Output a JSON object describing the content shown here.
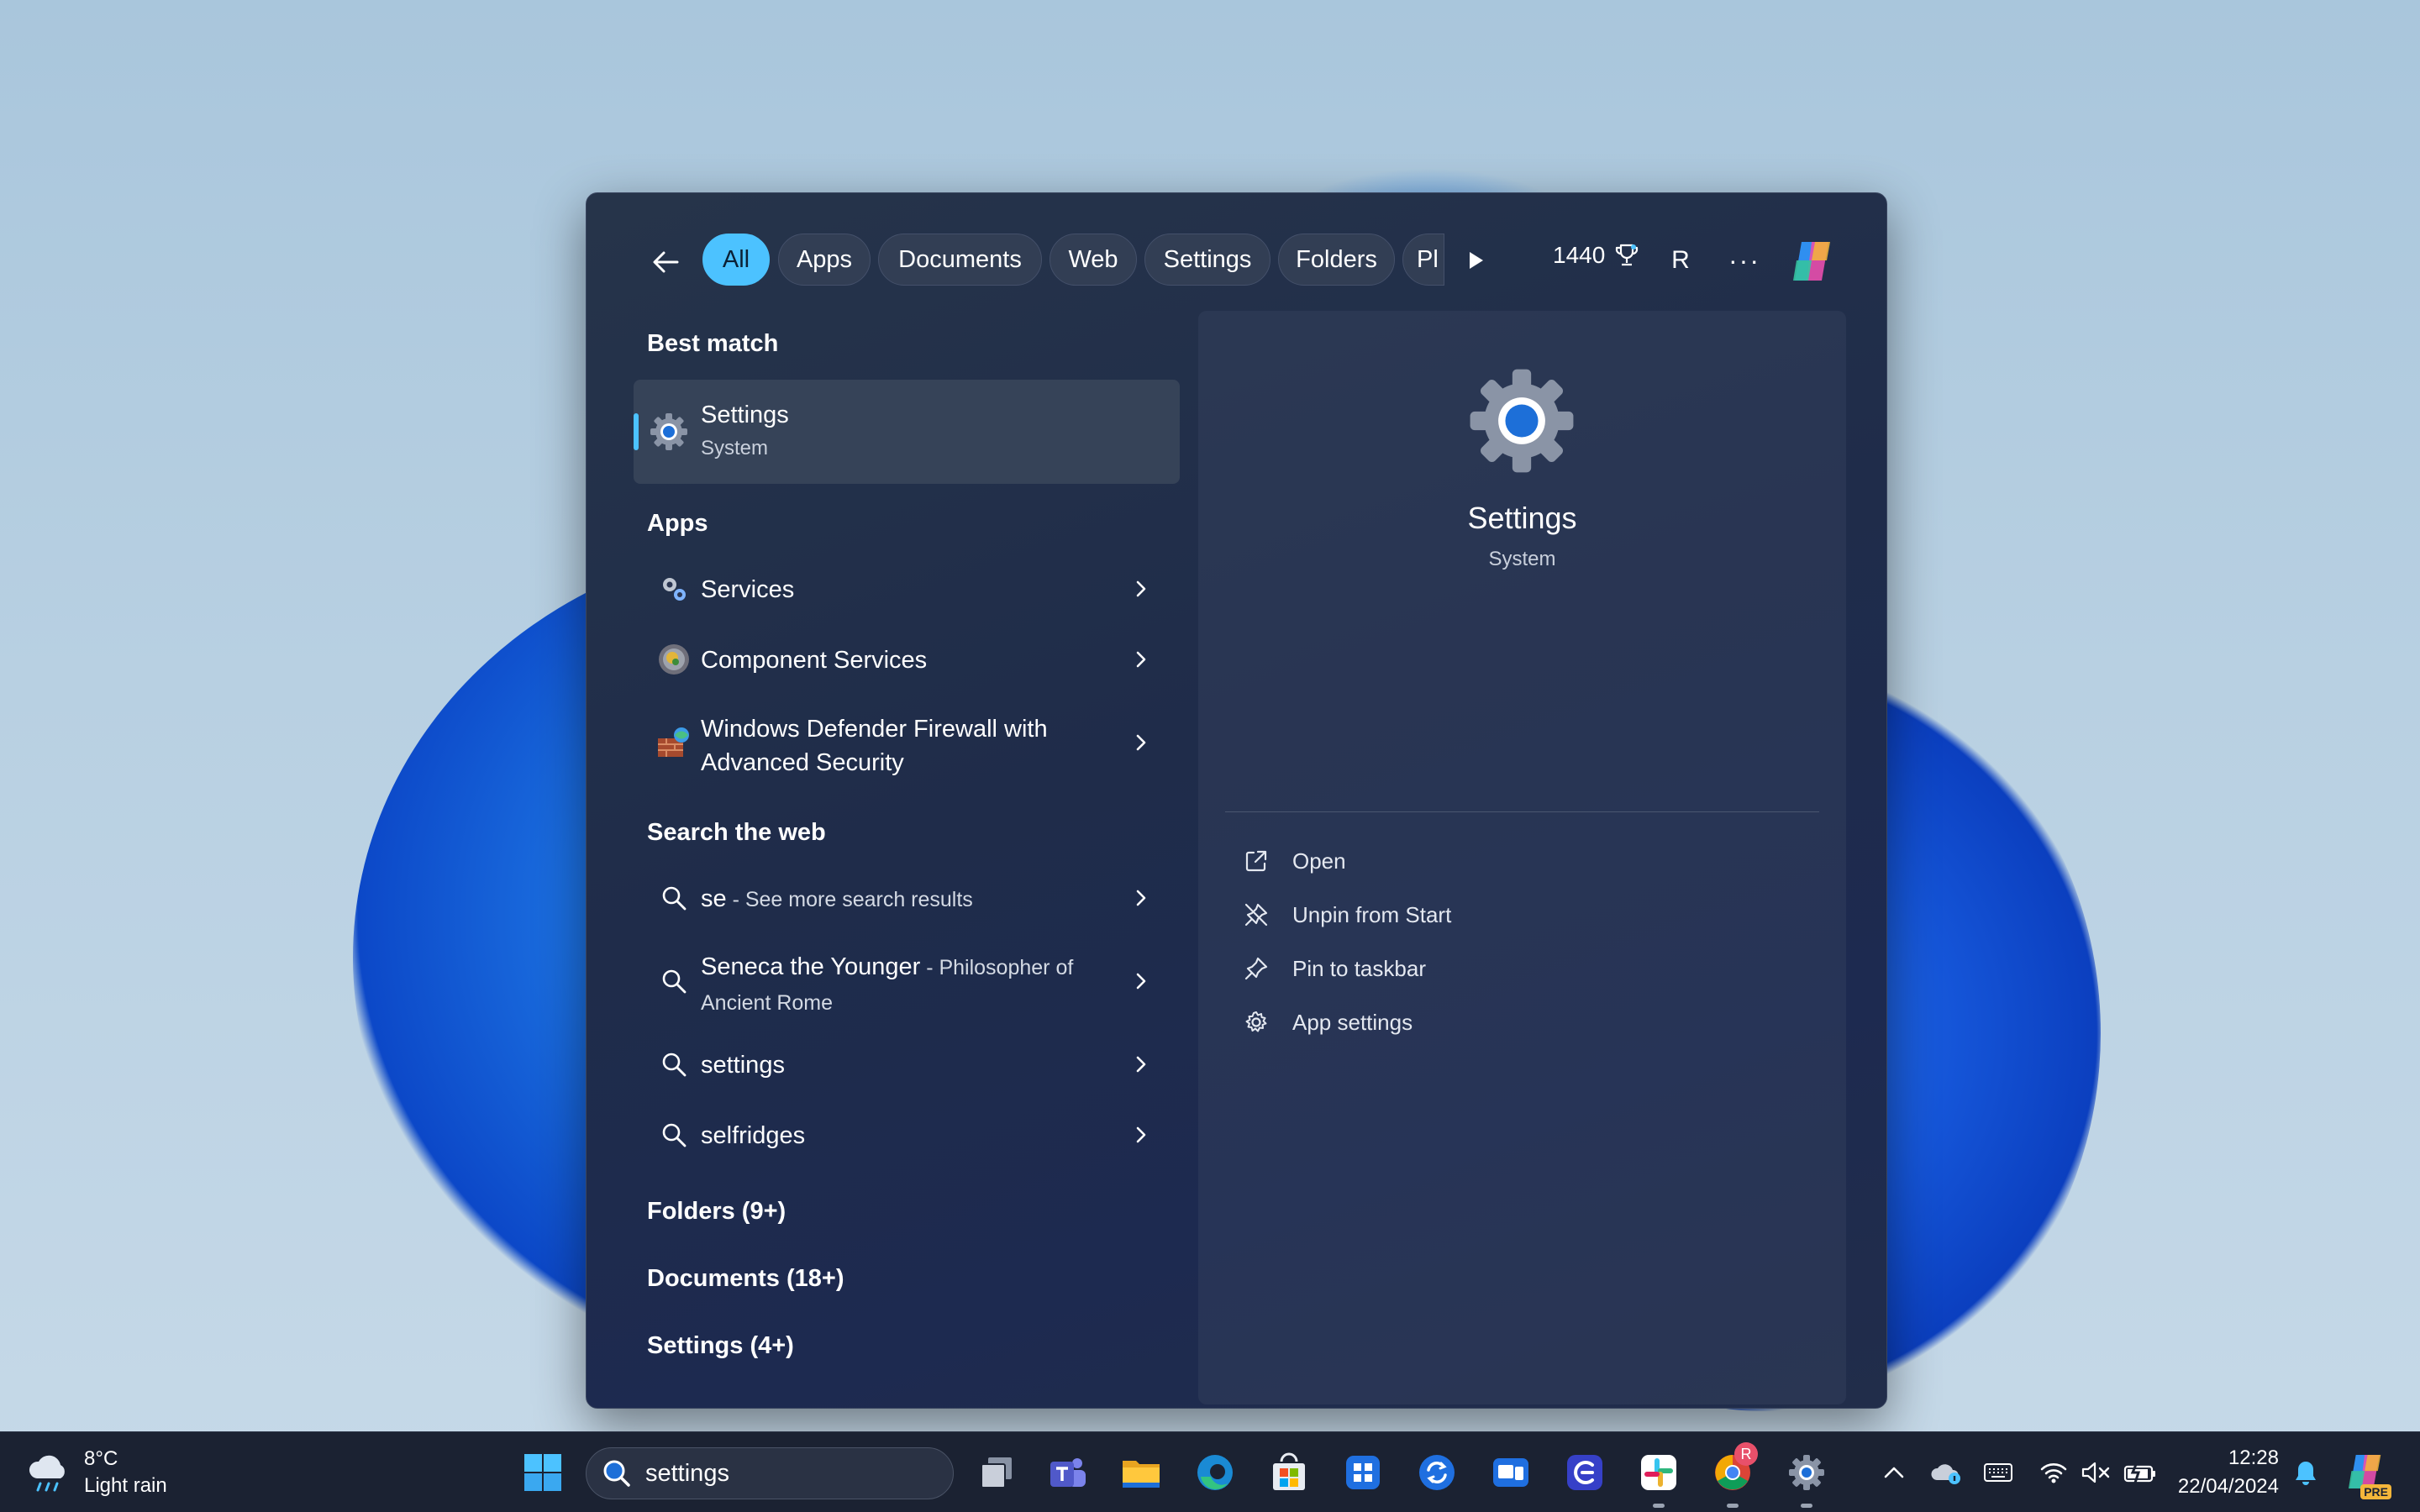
{
  "filters": {
    "back_label": "Back",
    "chips": [
      "All",
      "Apps",
      "Documents",
      "Web",
      "Settings",
      "Folders",
      "Pl"
    ],
    "active_chip": "All",
    "points": "1440",
    "avatar_initial": "R"
  },
  "results": {
    "best_match_heading": "Best match",
    "best_match": {
      "title": "Settings",
      "subtitle": "System"
    },
    "apps_heading": "Apps",
    "apps": [
      {
        "title": "Services"
      },
      {
        "title": "Component Services"
      },
      {
        "title": "Windows Defender Firewall with",
        "title2": "Advanced Security"
      }
    ],
    "web_heading": "Search the web",
    "web": [
      {
        "bold": "se",
        "rest": " - See more search results"
      },
      {
        "bold": "Seneca the Younger",
        "rest": " - Philosopher of",
        "rest2": "Ancient Rome"
      },
      {
        "bold": "settings",
        "rest": ""
      },
      {
        "bold": "selfridges",
        "rest": ""
      }
    ],
    "folders_heading": "Folders (9+)",
    "documents_heading": "Documents (18+)",
    "settings_heading": "Settings (4+)"
  },
  "detail": {
    "title": "Settings",
    "subtitle": "System",
    "actions": [
      "Open",
      "Unpin from Start",
      "Pin to taskbar",
      "App settings"
    ]
  },
  "taskbar": {
    "weather_temp": "8°C",
    "weather_desc": "Light rain",
    "search_value": "settings",
    "time": "12:28",
    "date": "22/04/2024",
    "chrome_badge": "R",
    "copilot_badge": "PRE"
  },
  "colors": {
    "accent": "#4cc2ff",
    "flyout_bg": "#1f2c4a",
    "taskbar_bg": "#1b2232"
  }
}
